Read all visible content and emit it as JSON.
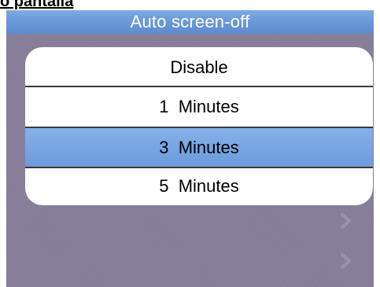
{
  "document": {
    "caption": "o pantalla"
  },
  "screen": {
    "title": "Auto screen-off",
    "options": [
      {
        "label": "Disable",
        "selected": false
      },
      {
        "label": "1  Minutes",
        "selected": false
      },
      {
        "label": "3  Minutes",
        "selected": true
      },
      {
        "label": "5  Minutes",
        "selected": false
      }
    ],
    "background_items": [
      {
        "icon": "chevron-right-icon"
      },
      {
        "icon": "chevron-right-icon"
      }
    ]
  },
  "colors": {
    "title_bar": "#6b98d8",
    "screen_background": "#877f9a",
    "selected_option": "#78a5e2",
    "list_background": "#ffffff"
  }
}
